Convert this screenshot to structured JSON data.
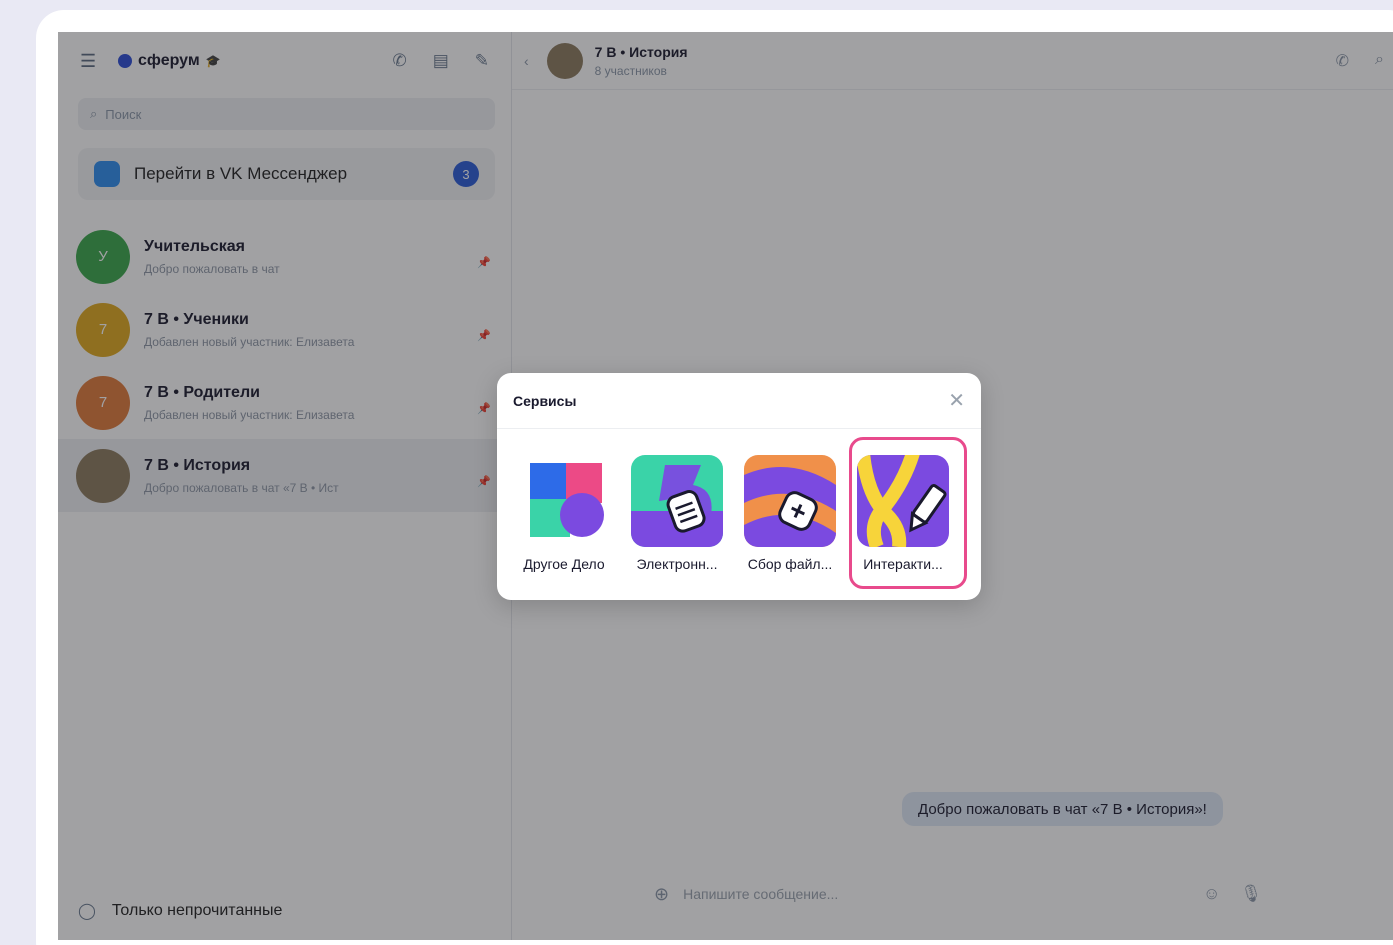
{
  "sidebar": {
    "brand": "сферум",
    "search_placeholder": "Поиск",
    "vk_messenger": {
      "label": "Перейти в VK Мессенджер",
      "badge": "3"
    },
    "chats": [
      {
        "name": "Учительская",
        "preview": "Добро пожаловать в чат",
        "avatar_letter": "У",
        "avatar_color": "#3aa84a",
        "active": false
      },
      {
        "name": "7 В • Ученики",
        "preview": "Добавлен новый участник: Елизавета",
        "avatar_letter": "7",
        "avatar_color": "#e0a91e",
        "active": false
      },
      {
        "name": "7 В • Родители",
        "preview": "Добавлен новый участник: Елизавета",
        "avatar_letter": "7",
        "avatar_color": "#e07a3a",
        "active": false
      },
      {
        "name": "7 В • История",
        "preview": "Добро пожаловать в чат «7 В • Ист",
        "avatar_letter": "",
        "avatar_color": "#8c7a5e",
        "active": true
      }
    ],
    "footer_label": "Только непрочитанные"
  },
  "chat": {
    "title": "7 В • История",
    "subtitle": "8 участников",
    "message": "Добро пожаловать в чат «7 В • История»!",
    "input_placeholder": "Напишите сообщение..."
  },
  "modal": {
    "title": "Сервисы",
    "services": [
      {
        "label": "Другое Дело",
        "icon": "drugoe-delo-icon"
      },
      {
        "label": "Электронн...",
        "icon": "electronic-journal-icon"
      },
      {
        "label": "Сбор файл...",
        "icon": "file-collection-icon"
      },
      {
        "label": "Интеракти...",
        "icon": "interactive-board-icon",
        "highlighted": true
      }
    ]
  },
  "colors": {
    "highlight": "#e84a8c",
    "accent": "#2a5cd8",
    "message_bubble": "#dfe9f7"
  }
}
